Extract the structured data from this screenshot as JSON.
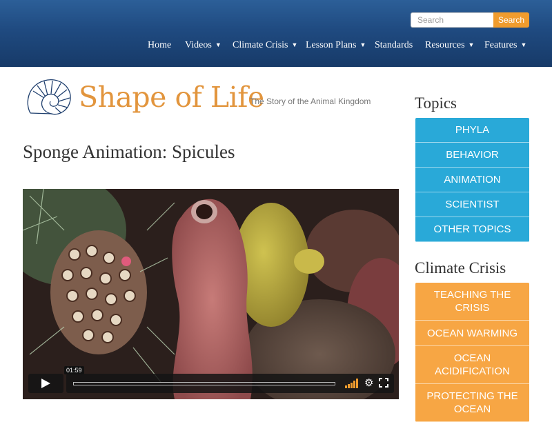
{
  "header": {
    "search_placeholder": "Search",
    "search_button": "Search",
    "nav": [
      {
        "label": "Home",
        "dropdown": false
      },
      {
        "label": "Videos",
        "dropdown": true
      },
      {
        "label": "Climate Crisis",
        "dropdown": true
      },
      {
        "label": "Lesson Plans",
        "dropdown": true
      },
      {
        "label": "Standards",
        "dropdown": false
      },
      {
        "label": "Resources",
        "dropdown": true
      },
      {
        "label": "Features",
        "dropdown": true
      }
    ],
    "caret": "▼"
  },
  "logo": {
    "title": "Shape of Life",
    "tagline": "The Story of the Animal Kingdom",
    "icon": "nautilus-shell-icon"
  },
  "page": {
    "title": "Sponge Animation: Spicules"
  },
  "video": {
    "time": "01:59",
    "progress": 0.0,
    "icons": [
      "play-icon",
      "volume-icon",
      "gear-icon",
      "fullscreen-icon"
    ]
  },
  "sidebar": {
    "topics_heading": "Topics",
    "topics": [
      "PHYLA",
      "BEHAVIOR",
      "ANIMATION",
      "SCIENTIST",
      "OTHER TOPICS"
    ],
    "climate_heading": "Climate Crisis",
    "climate": [
      "TEACHING THE CRISIS",
      "OCEAN WARMING",
      "OCEAN ACIDIFICATION",
      "PROTECTING THE OCEAN"
    ]
  },
  "colors": {
    "header_blue": "#1f4a80",
    "accent_orange": "#f09c2e",
    "topics_blue": "#29a9d8",
    "climate_orange": "#f7a644",
    "logo_orange": "#e2953d"
  }
}
